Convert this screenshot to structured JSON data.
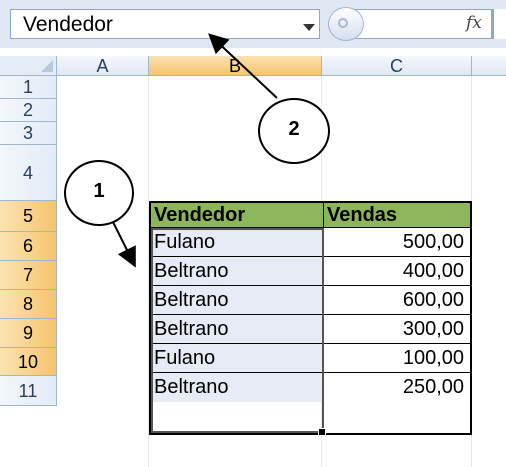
{
  "formula_bar": {
    "name_box_value": "Vendedor",
    "fx_label": "fx"
  },
  "columns": [
    "A",
    "B",
    "C"
  ],
  "rows": [
    "1",
    "2",
    "3",
    "4",
    "5",
    "6",
    "7",
    "8",
    "9",
    "10",
    "11"
  ],
  "table": {
    "headers": [
      "Vendedor",
      "Vendas"
    ],
    "rows": [
      [
        "Fulano",
        "500,00"
      ],
      [
        "Beltrano",
        "400,00"
      ],
      [
        "Beltrano",
        "600,00"
      ],
      [
        "Beltrano",
        "300,00"
      ],
      [
        "Fulano",
        "100,00"
      ],
      [
        "Beltrano",
        "250,00"
      ]
    ]
  },
  "callouts": {
    "one": "1",
    "two": "2"
  },
  "colors": {
    "header_green": "#8db65a",
    "selected_header": "#f6c46e",
    "selection_fill": "#e7ebf5"
  }
}
